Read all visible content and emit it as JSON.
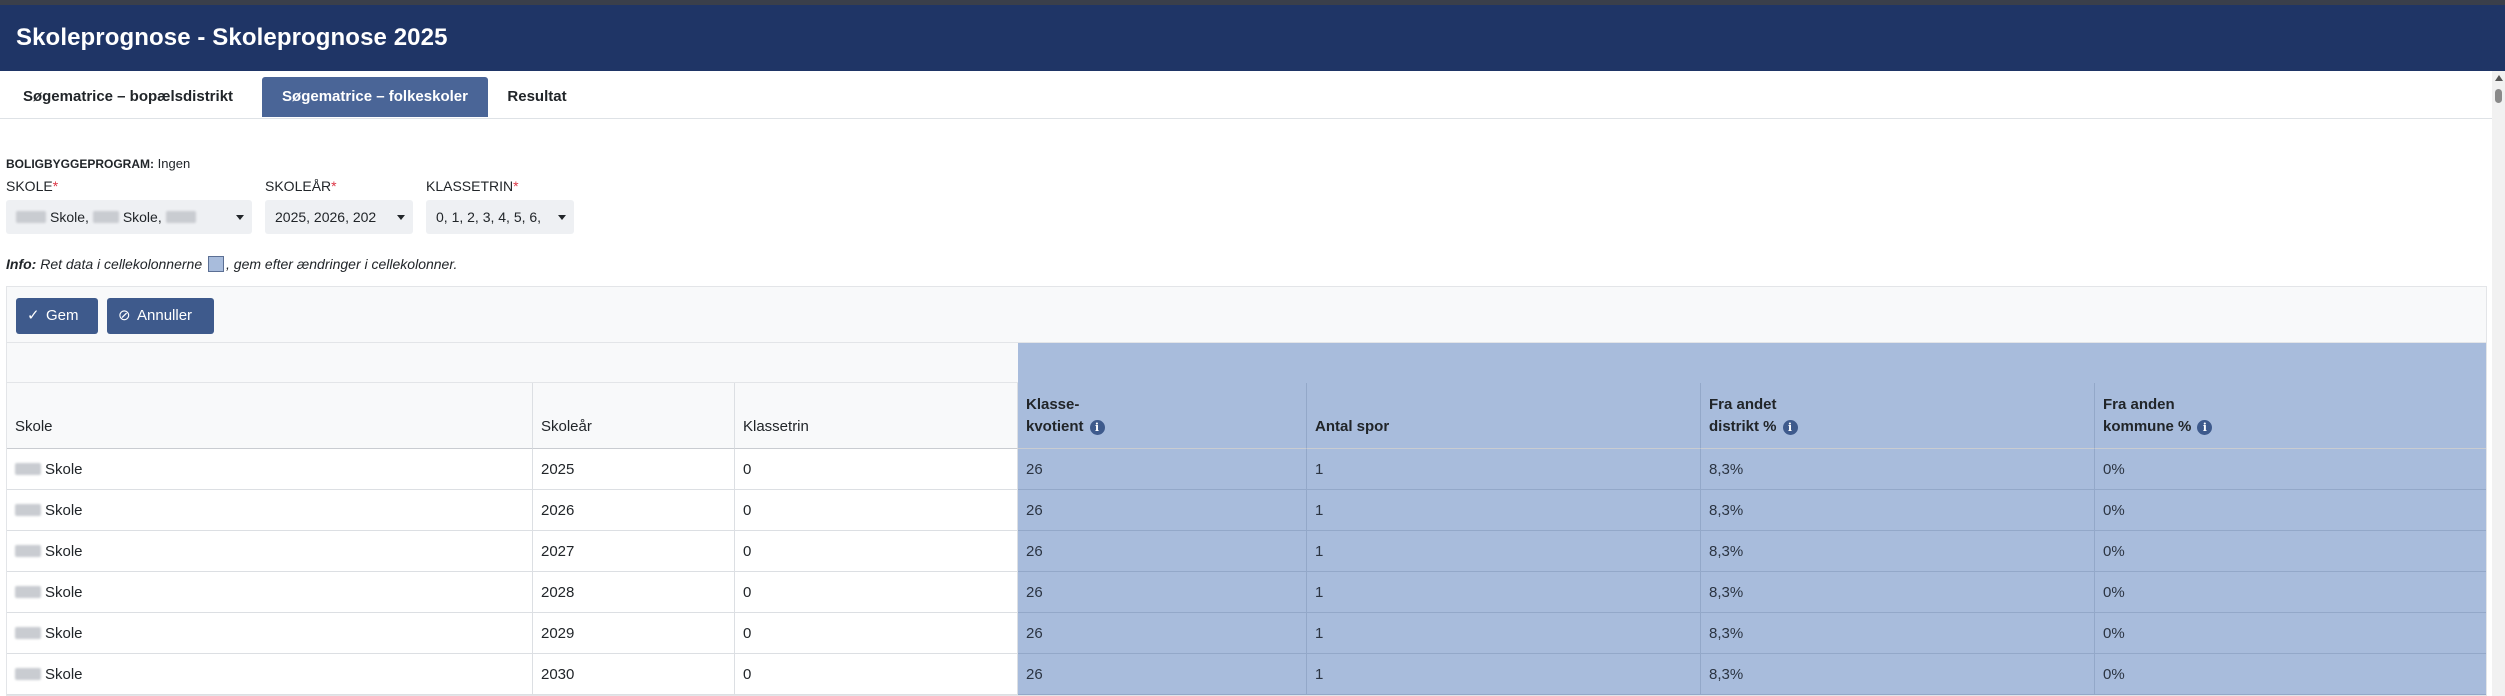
{
  "window": {
    "title": "Skoleprognose - Skoleprognose 2025"
  },
  "tabs": [
    {
      "label": "Søgematrice – bopælsdistrikt",
      "active": false
    },
    {
      "label": "Søgematrice – folkeskoler",
      "active": true
    },
    {
      "label": "Resultat",
      "active": false
    }
  ],
  "boligbyggeprogram": {
    "label": "BOLIGBYGGEPROGRAM:",
    "value": "Ingen"
  },
  "filters": {
    "skole": {
      "label": "SKOLE",
      "required_mark": "*",
      "value": "Skole, Skole,"
    },
    "skoleaar": {
      "label": "SKOLEÅR",
      "required_mark": "*",
      "value": "2025, 2026, 202"
    },
    "klassetrin": {
      "label": "KLASSETRIN",
      "required_mark": "*",
      "value": "0, 1, 2, 3, 4, 5, 6,"
    }
  },
  "info": {
    "prefix": "Info:",
    "text_before": "Ret data i cellekolonnerne",
    "text_after": ", gem efter ændringer i cellekolonner."
  },
  "toolbar": {
    "save_label": "Gem",
    "cancel_label": "Annuller"
  },
  "table": {
    "headers": {
      "skole": "Skole",
      "skoleaar": "Skoleår",
      "klassetrin": "Klassetrin",
      "klassekvotient_line1": "Klasse-",
      "klassekvotient_line2": "kvotient",
      "antal_spor": "Antal spor",
      "fra_andet_distrikt_line1": "Fra andet",
      "fra_andet_distrikt_line2": "distrikt %",
      "fra_anden_kommune_line1": "Fra anden",
      "fra_anden_kommune_line2": "kommune %"
    },
    "rows": [
      {
        "skole": "Skole",
        "skoleaar": "2025",
        "klassetrin": "0",
        "klassekvotient": "26",
        "antal_spor": "1",
        "fra_andet_distrikt": "8,3%",
        "fra_anden_kommune": "0%"
      },
      {
        "skole": "Skole",
        "skoleaar": "2026",
        "klassetrin": "0",
        "klassekvotient": "26",
        "antal_spor": "1",
        "fra_andet_distrikt": "8,3%",
        "fra_anden_kommune": "0%"
      },
      {
        "skole": "Skole",
        "skoleaar": "2027",
        "klassetrin": "0",
        "klassekvotient": "26",
        "antal_spor": "1",
        "fra_andet_distrikt": "8,3%",
        "fra_anden_kommune": "0%"
      },
      {
        "skole": "Skole",
        "skoleaar": "2028",
        "klassetrin": "0",
        "klassekvotient": "26",
        "antal_spor": "1",
        "fra_andet_distrikt": "8,3%",
        "fra_anden_kommune": "0%"
      },
      {
        "skole": "Skole",
        "skoleaar": "2029",
        "klassetrin": "0",
        "klassekvotient": "26",
        "antal_spor": "1",
        "fra_andet_distrikt": "8,3%",
        "fra_anden_kommune": "0%"
      },
      {
        "skole": "Skole",
        "skoleaar": "2030",
        "klassetrin": "0",
        "klassekvotient": "26",
        "antal_spor": "1",
        "fra_andet_distrikt": "8,3%",
        "fra_anden_kommune": "0%"
      }
    ]
  },
  "colors": {
    "header_bg": "#1f3566",
    "active_tab": "#4a6597",
    "button": "#3e5a8c",
    "editable_cell": "#a8bcdc"
  },
  "icons": {
    "save": "check-icon",
    "cancel": "ban-icon",
    "info": "info-circle-icon"
  }
}
